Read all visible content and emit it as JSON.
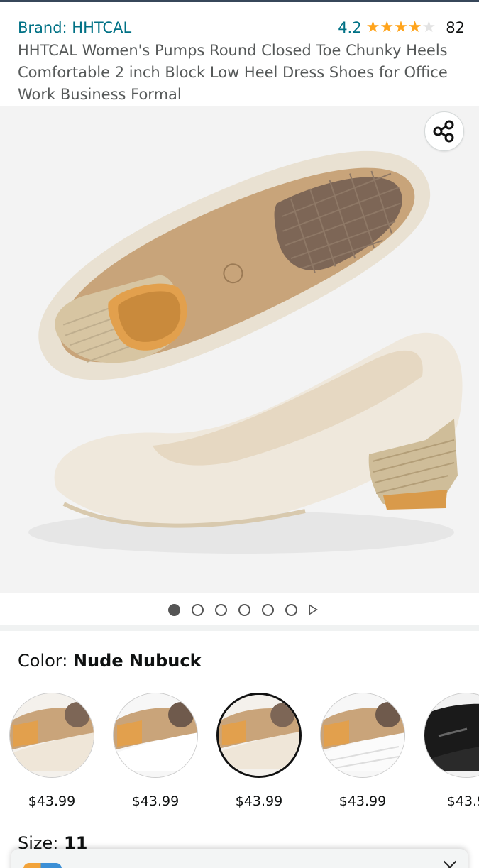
{
  "product": {
    "brand": "Brand: HHTCAL",
    "rating": "4.2",
    "rating_count": "82",
    "title": "HHTCAL Women's Pumps Round Closed Toe Chunky Heels Comfortable 2 inch Block Low Heel Dress Shoes for Office Work Business Formal"
  },
  "gallery": {
    "image_count": 6,
    "active_index": 0,
    "share_icon": "share-icon",
    "play_icon": "play-icon"
  },
  "color": {
    "label": "Color:",
    "selected": "Nude Nubuck",
    "options": [
      {
        "price": "$43.99",
        "tone": "nude-beige"
      },
      {
        "price": "$43.99",
        "tone": "white"
      },
      {
        "price": "$43.99",
        "tone": "nude-nubuck",
        "selected": true
      },
      {
        "price": "$43.99",
        "tone": "white-quilted"
      },
      {
        "price": "$43.9",
        "tone": "black"
      }
    ]
  },
  "size": {
    "label": "Size:",
    "selected": "11"
  },
  "colors": {
    "link": "#007185",
    "star": "#ffa41c",
    "text": "#0f1111"
  }
}
